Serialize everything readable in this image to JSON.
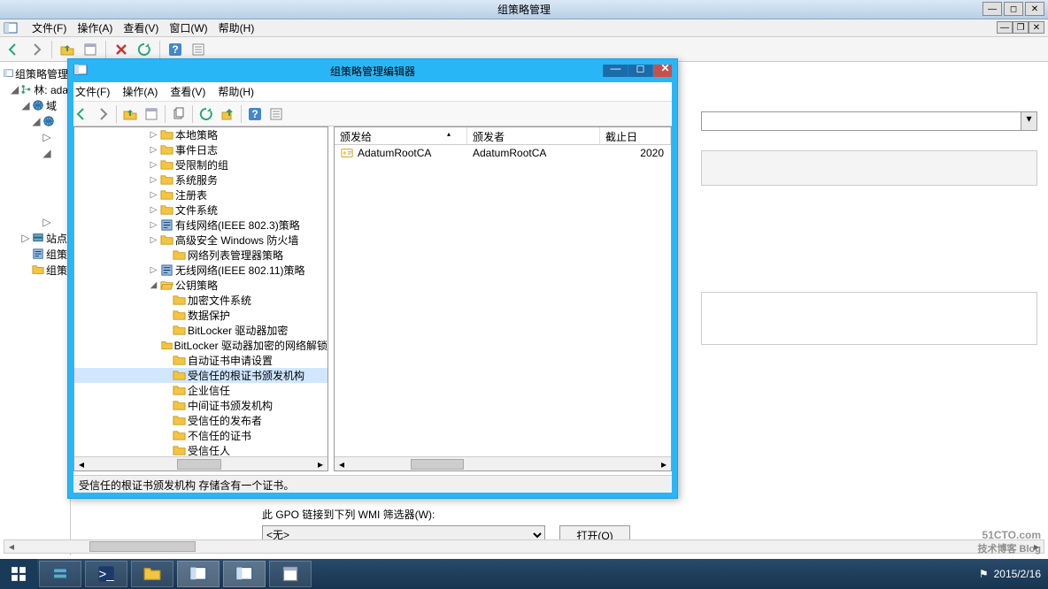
{
  "parent": {
    "title": "组策略管理",
    "menu": {
      "file": "文件(F)",
      "action": "操作(A)",
      "view": "查看(V)",
      "window": "窗口(W)",
      "help": "帮助(H)"
    },
    "tree": {
      "root": "组策略管理",
      "forest": "林: ada",
      "domains": "域",
      "sites": "站点",
      "gpm": "组策",
      "gpr": "组策"
    }
  },
  "editor": {
    "title": "组策略管理编辑器",
    "menu": {
      "file": "文件(F)",
      "action": "操作(A)",
      "view": "查看(V)",
      "help": "帮助(H)"
    },
    "tree": [
      {
        "indent": 2,
        "ex": "▷",
        "icon": "folder",
        "label": "本地策略"
      },
      {
        "indent": 2,
        "ex": "▷",
        "icon": "folder",
        "label": "事件日志"
      },
      {
        "indent": 2,
        "ex": "▷",
        "icon": "folder",
        "label": "受限制的组"
      },
      {
        "indent": 2,
        "ex": "▷",
        "icon": "folder",
        "label": "系统服务"
      },
      {
        "indent": 2,
        "ex": "▷",
        "icon": "folder",
        "label": "注册表"
      },
      {
        "indent": 2,
        "ex": "▷",
        "icon": "folder",
        "label": "文件系统"
      },
      {
        "indent": 2,
        "ex": "▷",
        "icon": "policy",
        "label": "有线网络(IEEE 802.3)策略"
      },
      {
        "indent": 2,
        "ex": "▷",
        "icon": "folder",
        "label": "高级安全 Windows 防火墙"
      },
      {
        "indent": 3,
        "ex": "",
        "icon": "folder",
        "label": "网络列表管理器策略"
      },
      {
        "indent": 2,
        "ex": "▷",
        "icon": "policy",
        "label": "无线网络(IEEE 802.11)策略"
      },
      {
        "indent": 2,
        "ex": "◢",
        "icon": "folder-open",
        "label": "公钥策略"
      },
      {
        "indent": 3,
        "ex": "",
        "icon": "folder",
        "label": "加密文件系统"
      },
      {
        "indent": 3,
        "ex": "",
        "icon": "folder",
        "label": "数据保护"
      },
      {
        "indent": 3,
        "ex": "",
        "icon": "folder",
        "label": "BitLocker 驱动器加密"
      },
      {
        "indent": 3,
        "ex": "",
        "icon": "folder",
        "label": "BitLocker 驱动器加密的网络解锁"
      },
      {
        "indent": 3,
        "ex": "",
        "icon": "folder",
        "label": "自动证书申请设置"
      },
      {
        "indent": 3,
        "ex": "",
        "icon": "folder",
        "label": "受信任的根证书颁发机构",
        "sel": true
      },
      {
        "indent": 3,
        "ex": "",
        "icon": "folder",
        "label": "企业信任"
      },
      {
        "indent": 3,
        "ex": "",
        "icon": "folder",
        "label": "中间证书颁发机构"
      },
      {
        "indent": 3,
        "ex": "",
        "icon": "folder",
        "label": "受信任的发布者"
      },
      {
        "indent": 3,
        "ex": "",
        "icon": "folder",
        "label": "不信任的证书"
      },
      {
        "indent": 3,
        "ex": "",
        "icon": "folder",
        "label": "受信任人"
      }
    ],
    "list": {
      "cols": {
        "issued_to": "颁发给",
        "issuer": "颁发者",
        "expires": "截止日"
      },
      "rows": [
        {
          "issued_to": "AdatumRootCA",
          "issuer": "AdatumRootCA",
          "expires": "2020"
        }
      ]
    },
    "status": "受信任的根证书颁发机构 存储含有一个证书。"
  },
  "wmi": {
    "label": "此 GPO 链接到下列 WMI 筛选器(W):",
    "selected": "<无>",
    "open": "打开(O)"
  },
  "taskbar": {
    "date": "2015/2/16"
  },
  "watermark": {
    "main": "51CTO.com",
    "sub": "技术博客  Blog"
  }
}
